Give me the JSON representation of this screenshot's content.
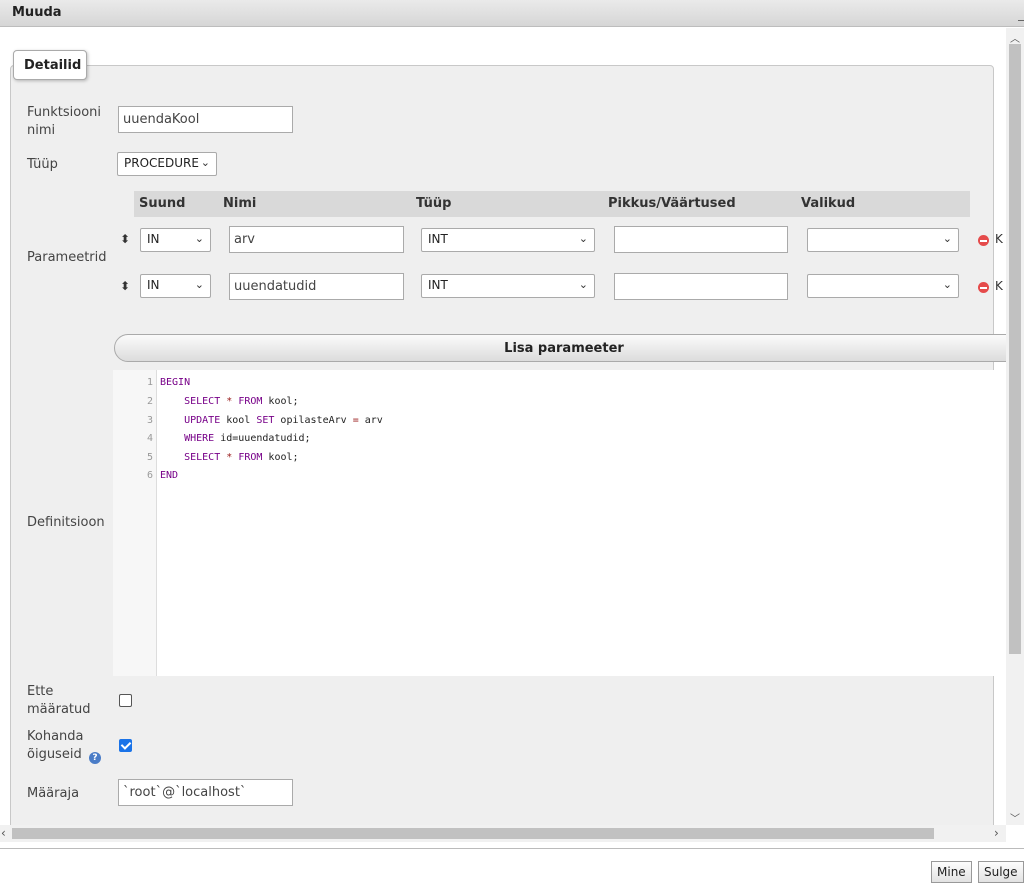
{
  "window": {
    "title": "Muuda"
  },
  "section": {
    "legend": "Detailid"
  },
  "form": {
    "name_label": "Funktsiooni nimi",
    "name_value": "uuendaKool",
    "type_label": "Tüüp",
    "type_value": "PROCEDURE",
    "params_label": "Parameetrid",
    "definition_label": "Definitsioon",
    "deterministic_label": "Ette määratud",
    "deterministic_checked": false,
    "adjust_privileges_label": "Kohanda õiguseid",
    "adjust_privileges_checked": true,
    "definer_label": "Määraja",
    "definer_value": "`root`@`localhost`"
  },
  "params": {
    "headers": [
      "Suund",
      "Nimi",
      "Tüüp",
      "Pikkus/Väärtused",
      "Valikud"
    ],
    "rows": [
      {
        "direction": "IN",
        "name": "arv",
        "type": "INT",
        "length": "",
        "options": "",
        "remove_label": "K"
      },
      {
        "direction": "IN",
        "name": "uuendatudid",
        "type": "INT",
        "length": "",
        "options": "",
        "remove_label": "K"
      }
    ],
    "add_button": "Lisa parameeter"
  },
  "editor": {
    "line_numbers": [
      "1",
      "2",
      "3",
      "4",
      "5",
      "6"
    ],
    "lines": [
      "BEGIN",
      "    SELECT * FROM kool;",
      "    UPDATE kool SET opilasteArv = arv",
      "    WHERE id=uuendatudid;",
      "    SELECT * FROM kool;",
      "END"
    ]
  },
  "footer": {
    "go_button": "Mine",
    "close_button": "Sulge"
  },
  "icons": {
    "drag": "drag-handle-icon",
    "remove": "remove-circle-icon",
    "help": "help-icon",
    "chevron": "chevron-down-icon"
  },
  "colors": {
    "accent": "#1a73e8",
    "remove": "#e54b4b",
    "keyword": "#770088"
  }
}
